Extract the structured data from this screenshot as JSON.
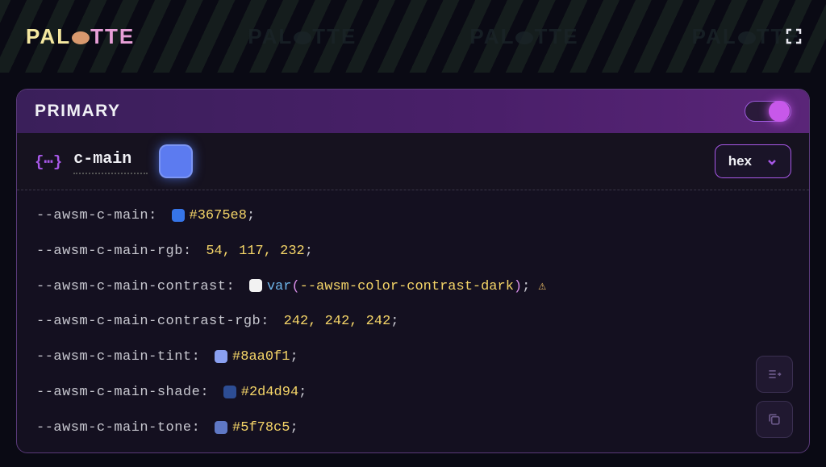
{
  "app": {
    "logo_text_1": "PAL",
    "logo_text_2": "TTE"
  },
  "card": {
    "section_title": "PRIMARY",
    "color_name": "c-main",
    "main_swatch_color": "#5c7bf0",
    "format_selected": "hex",
    "toggle_on": true
  },
  "variables": [
    {
      "name": "--awsm-c-main",
      "swatch": "#3675e8",
      "value": "#3675e8",
      "type": "plain"
    },
    {
      "name": "--awsm-c-main-rgb",
      "swatch": null,
      "value": "54, 117, 232",
      "type": "plain"
    },
    {
      "name": "--awsm-c-main-contrast",
      "swatch": "#f2f2f2",
      "func": "var",
      "arg": "--awsm-color-contrast-dark",
      "type": "func",
      "warn": true
    },
    {
      "name": "--awsm-c-main-contrast-rgb",
      "swatch": null,
      "value": "242, 242, 242",
      "type": "plain"
    },
    {
      "name": "--awsm-c-main-tint",
      "swatch": "#8aa0f1",
      "value": "#8aa0f1",
      "type": "plain"
    },
    {
      "name": "--awsm-c-main-shade",
      "swatch": "#2d4d94",
      "value": "#2d4d94",
      "type": "plain"
    },
    {
      "name": "--awsm-c-main-tone",
      "swatch": "#5f78c5",
      "value": "#5f78c5",
      "type": "plain"
    }
  ]
}
